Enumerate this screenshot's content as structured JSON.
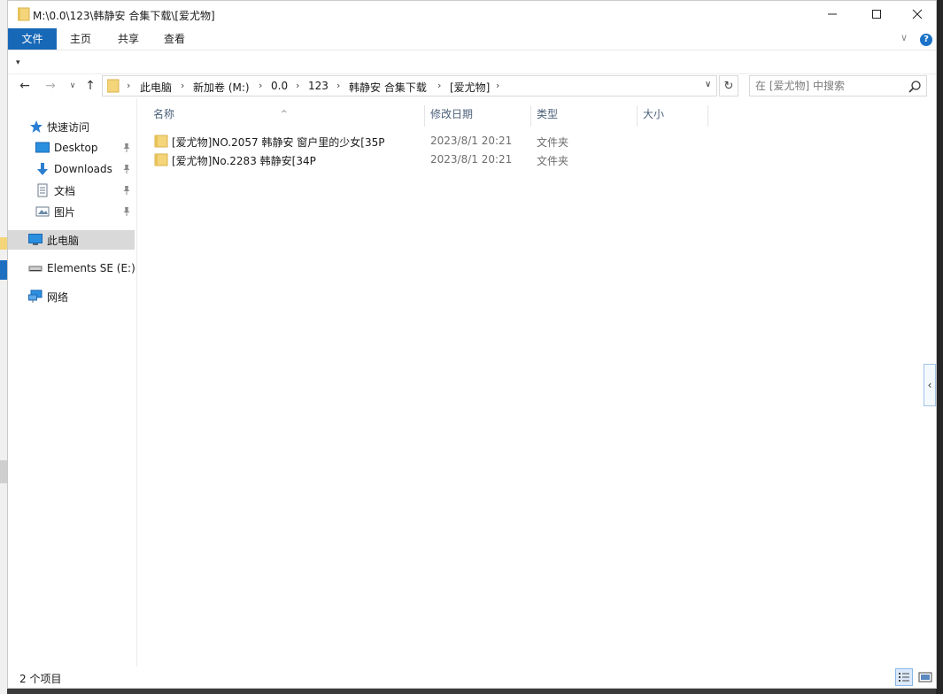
{
  "window": {
    "title": "M:\\0.0\\123\\韩静安 合集下载\\[爱尤物]",
    "controls": {
      "minimize": "—",
      "maximize": "☐",
      "close": "✕"
    }
  },
  "ribbon": {
    "tabs": [
      {
        "label": "文件"
      },
      {
        "label": "主页"
      },
      {
        "label": "共享"
      },
      {
        "label": "查看"
      }
    ],
    "expand_glyph": "∨",
    "help_glyph": "?"
  },
  "qat": {
    "dropdown_glyph": "▾"
  },
  "nav": {
    "back": "←",
    "forward": "→",
    "recent": "∨",
    "up": "↑"
  },
  "address": {
    "crumbs": [
      "此电脑",
      "新加卷 (M:)",
      "0.0",
      "123",
      "韩静安 合集下载",
      "[爱尤物]"
    ],
    "separator": "›",
    "dropdown_glyph": "∨",
    "refresh_glyph": "↻"
  },
  "search": {
    "placeholder": "在 [爱尤物] 中搜索"
  },
  "navpane": {
    "items": [
      {
        "label": "快速访问",
        "icon": "star-icon",
        "pinned": false
      },
      {
        "label": "Desktop",
        "icon": "desktop-icon",
        "pinned": true
      },
      {
        "label": "Downloads",
        "icon": "download-icon",
        "pinned": true
      },
      {
        "label": "文档",
        "icon": "documents-icon",
        "pinned": true
      },
      {
        "label": "图片",
        "icon": "pictures-icon",
        "pinned": true
      },
      {
        "label": "此电脑",
        "icon": "computer-icon",
        "pinned": false,
        "selected": true
      },
      {
        "label": "Elements SE (E:)",
        "icon": "drive-icon",
        "pinned": false
      },
      {
        "label": "网络",
        "icon": "network-icon",
        "pinned": false
      }
    ]
  },
  "columns": {
    "name": "名称",
    "date": "修改日期",
    "type": "类型",
    "size": "大小",
    "sort_glyph": "^"
  },
  "files": [
    {
      "name": "[爱尤物]NO.2057 韩静安 窗户里的少女[35P",
      "date": "2023/8/1 20:21",
      "type": "文件夹",
      "icon": "folder-icon"
    },
    {
      "name": "[爱尤物]No.2283 韩静安[34P",
      "date": "2023/8/1 20:21",
      "type": "文件夹",
      "icon": "folder-icon"
    }
  ],
  "status": {
    "item_count": "2 个项目"
  },
  "preview_pane_handle": "‹",
  "colors": {
    "accent": "#1868b8",
    "folder": "#f5d57a",
    "selected_nav": "#d9d9d9",
    "column_header_text": "#4c607a"
  }
}
